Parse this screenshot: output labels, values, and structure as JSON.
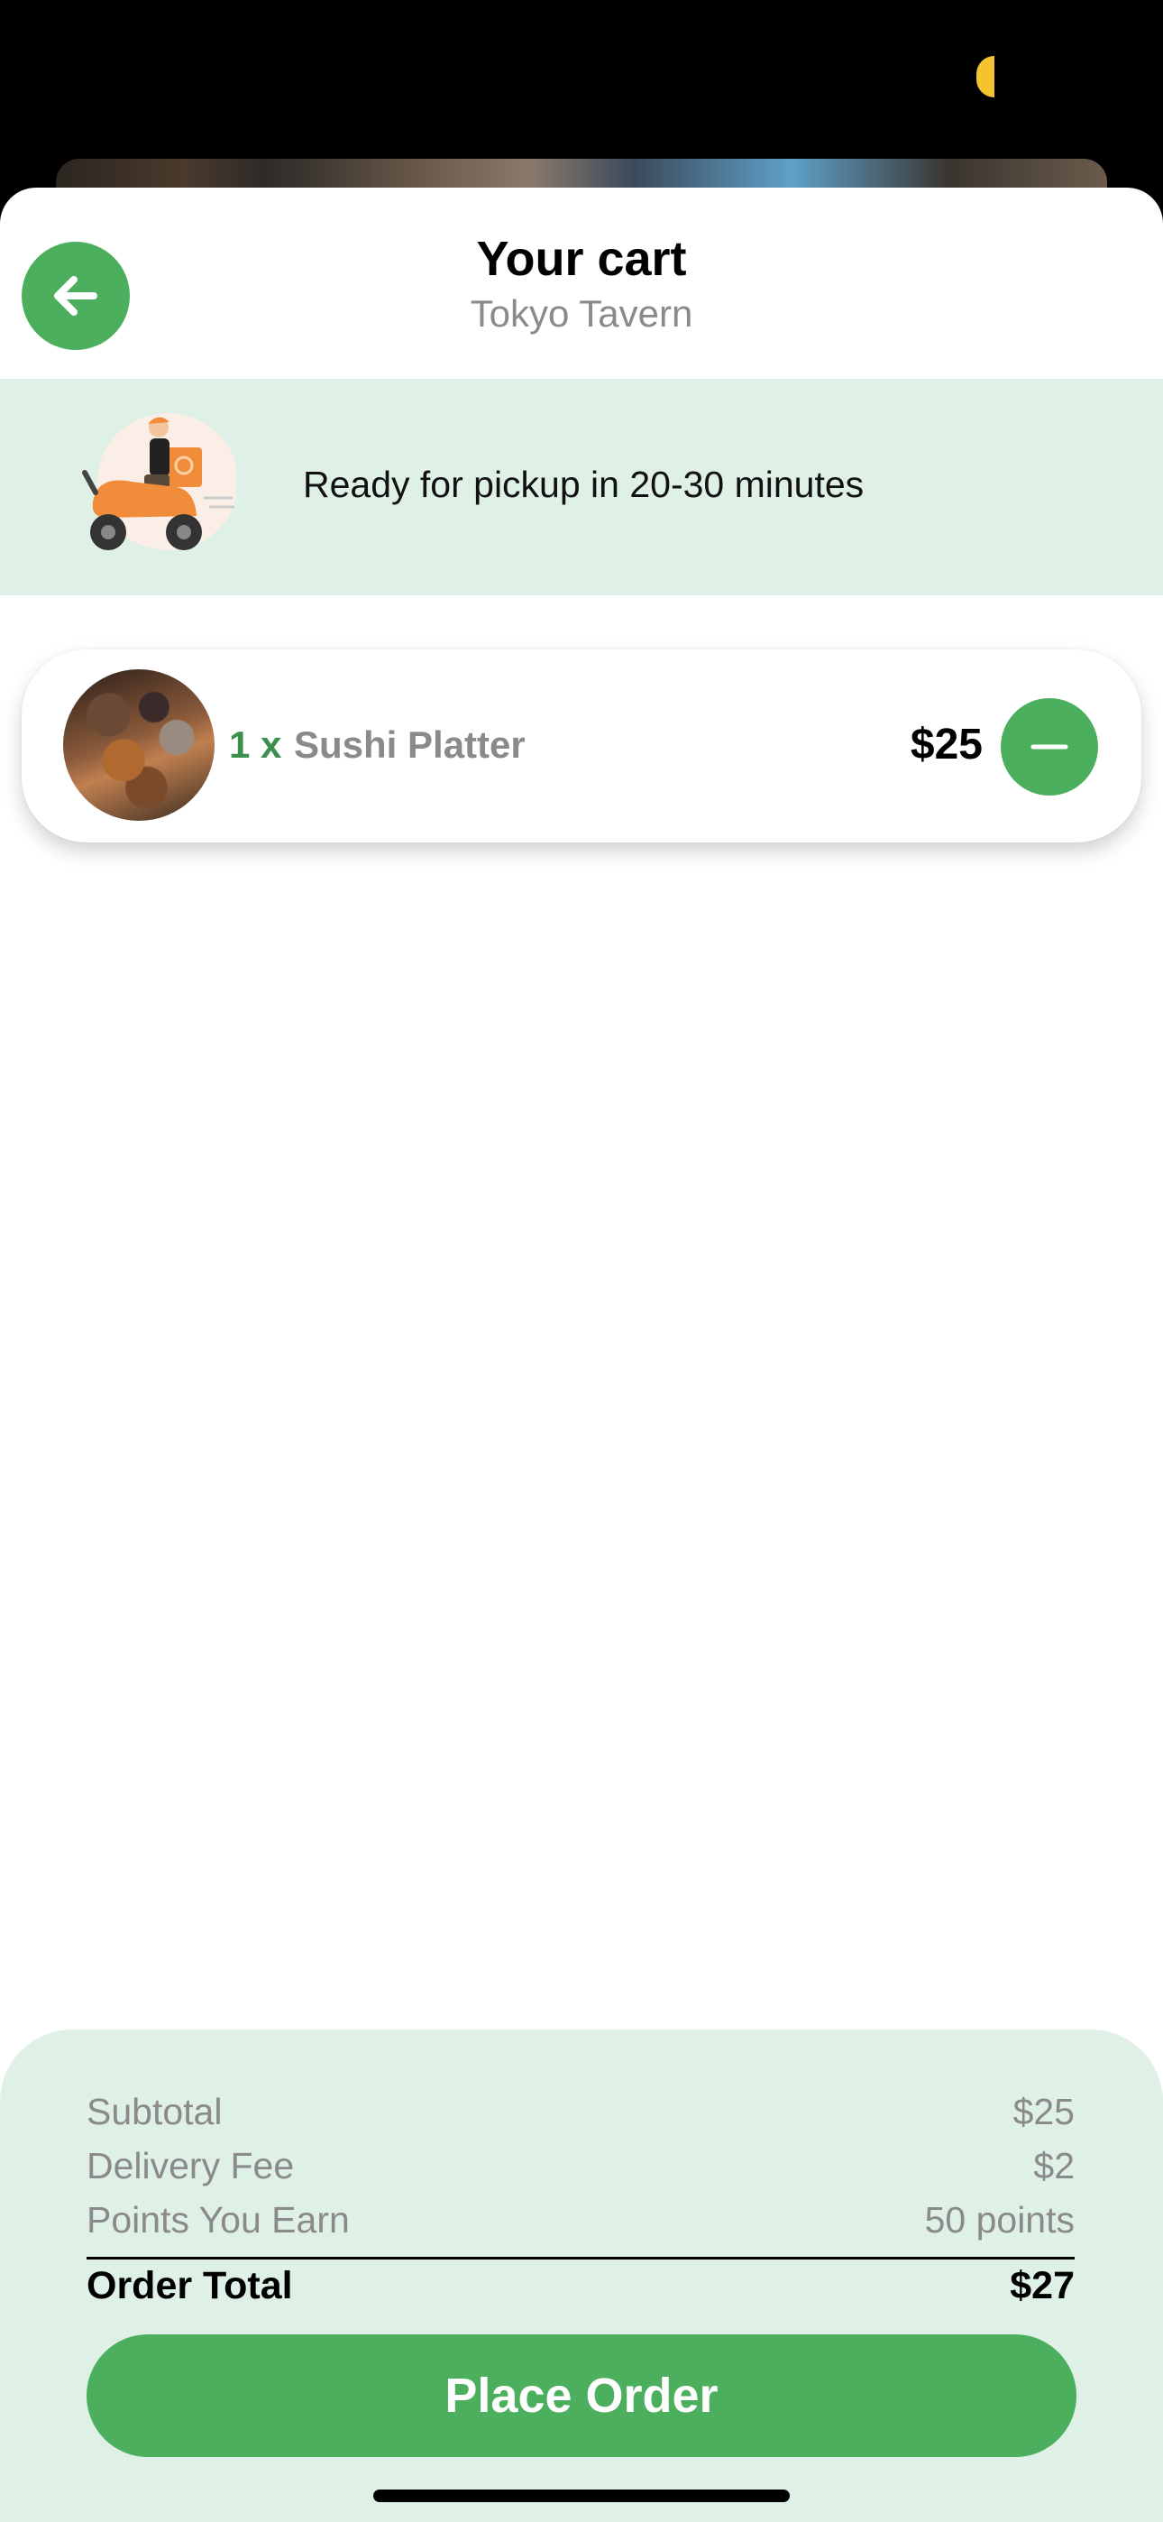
{
  "header": {
    "title": "Your cart",
    "restaurant": "Tokyo Tavern"
  },
  "pickup": {
    "message": "Ready for pickup in 20-30 minutes"
  },
  "cart": {
    "items": [
      {
        "quantity": "1 x",
        "name": "Sushi Platter",
        "price": "$25"
      }
    ]
  },
  "summary": {
    "subtotal_label": "Subtotal",
    "subtotal_value": "$25",
    "delivery_label": "Delivery Fee",
    "delivery_value": "$2",
    "points_label": "Points You Earn",
    "points_value": "50 points",
    "total_label": "Order Total",
    "total_value": "$27"
  },
  "actions": {
    "place_order_label": "Place Order"
  },
  "colors": {
    "accent": "#4caf5e",
    "banner_bg": "#dff1e6",
    "muted_text": "#8a8a8a"
  }
}
